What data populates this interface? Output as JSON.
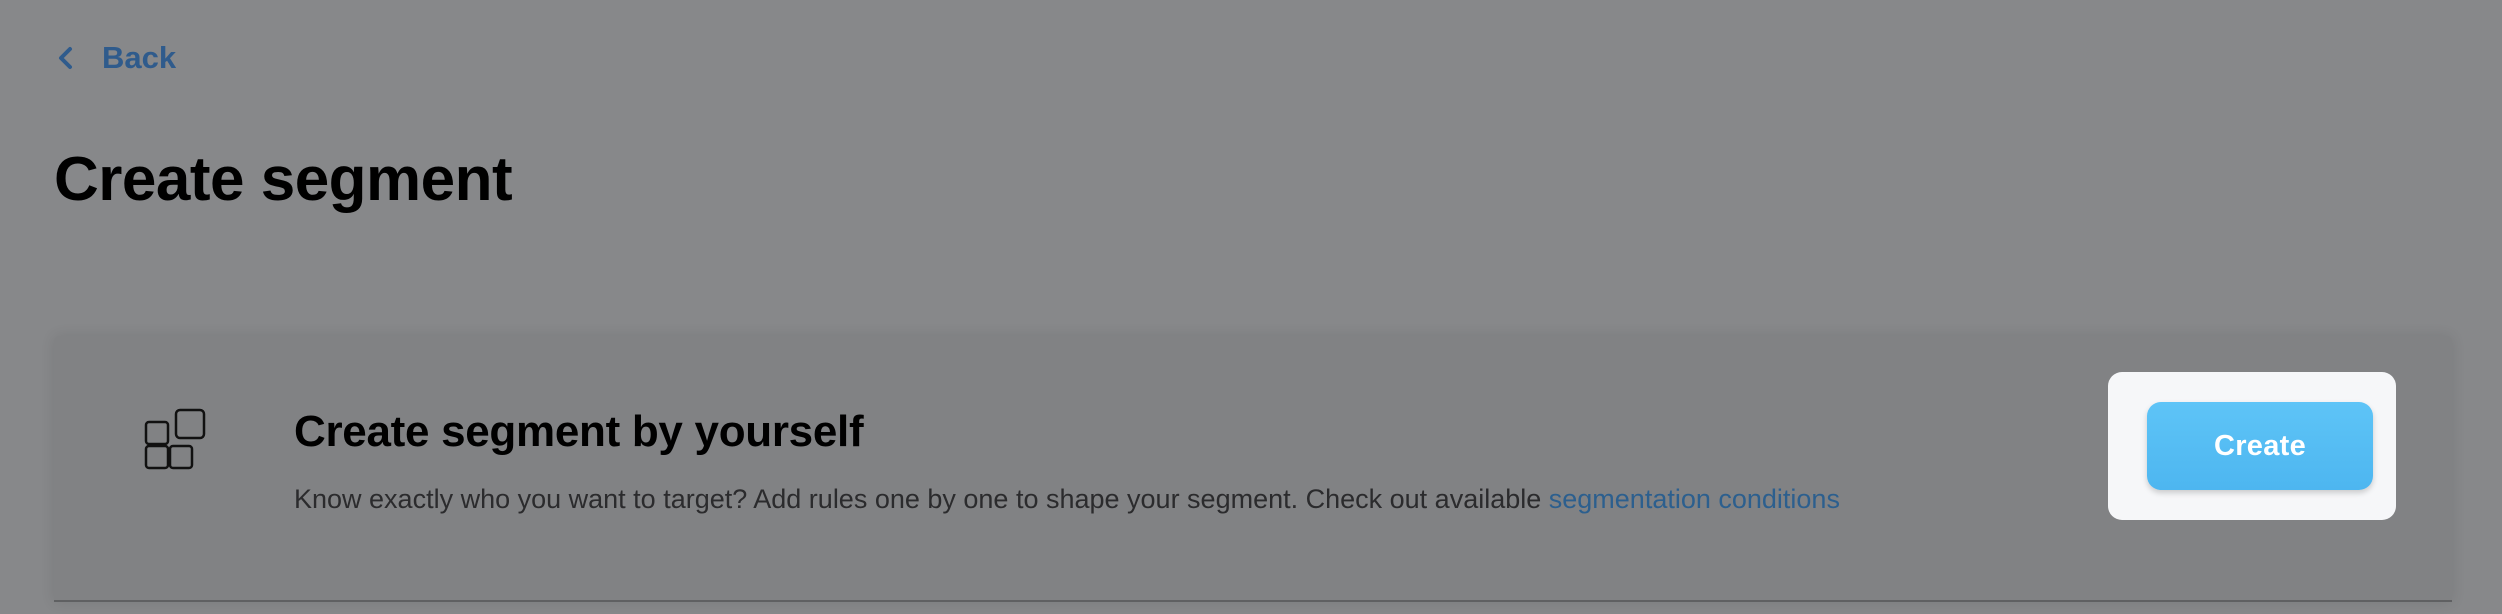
{
  "nav": {
    "back_label": "Back",
    "back_icon": "chevron-left-icon"
  },
  "page": {
    "title": "Create segment"
  },
  "card": {
    "icon": "blocks-icon",
    "title": "Create segment by yourself",
    "description": "Know exactly who you want to target? Add rules one by one to shape your segment. Check out available ",
    "link_text": "segmentation conditions",
    "button_label": "Create"
  },
  "colors": {
    "overlay_background": "#87888a",
    "link": "#2c5f8e",
    "button": "#56bdf4",
    "highlight": "#f6f7f9"
  }
}
